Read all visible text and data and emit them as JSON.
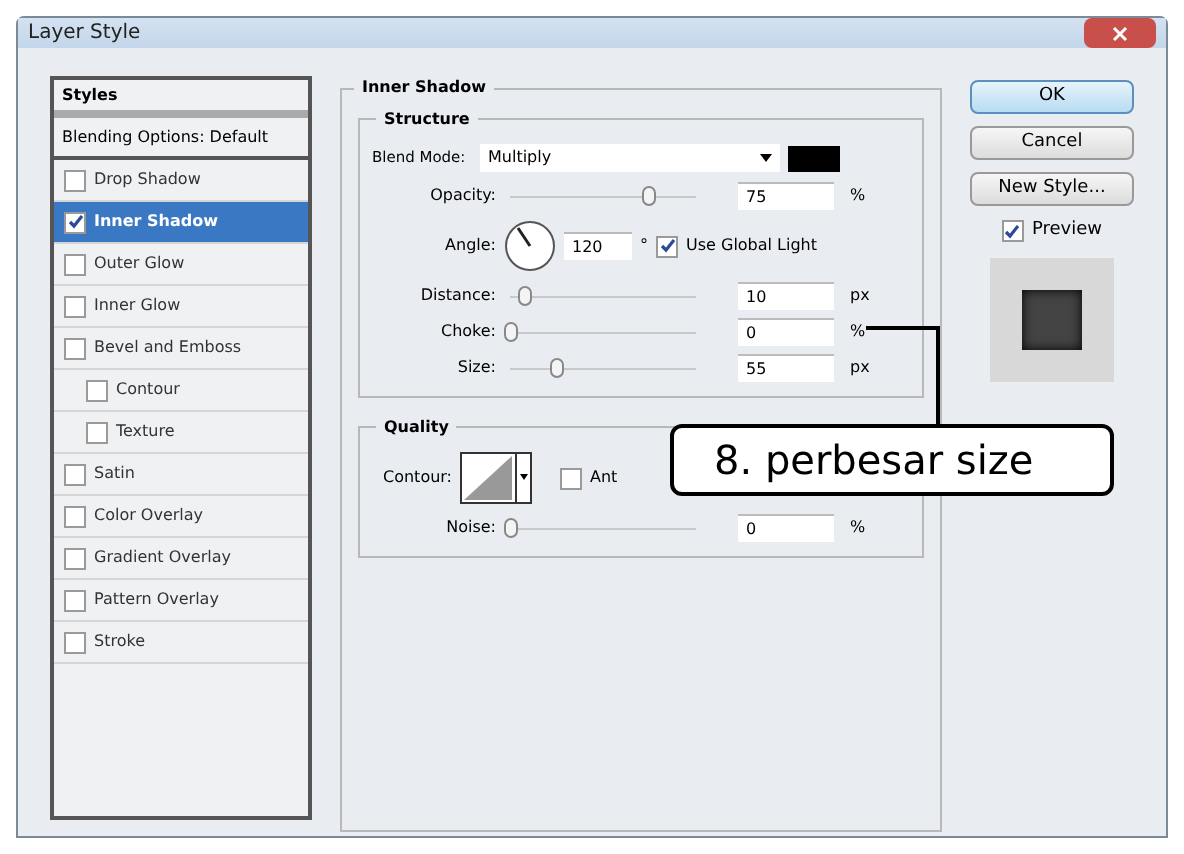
{
  "window": {
    "title": "Layer Style"
  },
  "sidebar": {
    "header": "Styles",
    "blending": "Blending Options: Default",
    "items": [
      {
        "label": "Drop Shadow",
        "checked": false,
        "selected": false
      },
      {
        "label": "Inner Shadow",
        "checked": true,
        "selected": true
      },
      {
        "label": "Outer Glow",
        "checked": false,
        "selected": false
      },
      {
        "label": "Inner Glow",
        "checked": false,
        "selected": false
      },
      {
        "label": "Bevel and Emboss",
        "checked": false,
        "selected": false,
        "children": [
          {
            "label": "Contour",
            "checked": false,
            "selected": false
          },
          {
            "label": "Texture",
            "checked": false,
            "selected": false
          }
        ]
      },
      {
        "label": "Satin",
        "checked": false,
        "selected": false
      },
      {
        "label": "Color Overlay",
        "checked": false,
        "selected": false
      },
      {
        "label": "Gradient Overlay",
        "checked": false,
        "selected": false
      },
      {
        "label": "Pattern Overlay",
        "checked": false,
        "selected": false
      },
      {
        "label": "Stroke",
        "checked": false,
        "selected": false
      }
    ]
  },
  "panel": {
    "title": "Inner Shadow",
    "structure": {
      "title": "Structure",
      "blend_mode": {
        "label": "Blend Mode:",
        "value": "Multiply"
      },
      "opacity": {
        "label": "Opacity:",
        "level": 0.75,
        "value": "75",
        "unit": "%"
      },
      "angle": {
        "label": "Angle:",
        "value": "120",
        "unit": "°",
        "global_light": {
          "label": "Use Global Light",
          "checked": true
        }
      },
      "sliders": [
        {
          "label": "Distance:",
          "level": 0.08,
          "value": "10",
          "unit": "px"
        },
        {
          "label": "Choke:",
          "level": 0,
          "value": "0",
          "unit": "%"
        },
        {
          "label": "Size:",
          "level": 0.25,
          "value": "55",
          "unit": "px"
        }
      ]
    },
    "quality": {
      "title": "Quality",
      "contour_label": "Contour:",
      "anti_aliased": {
        "label": "Ant",
        "checked": false
      },
      "noise": {
        "label": "Noise:",
        "level": 0,
        "value": "0",
        "unit": "%"
      }
    }
  },
  "buttons": [
    {
      "label": "OK",
      "default": true
    },
    {
      "label": "Cancel",
      "default": false
    },
    {
      "label": "New Style...",
      "default": false
    }
  ],
  "preview": {
    "label": "Preview",
    "checked": true
  },
  "callout": "8. perbesar size"
}
